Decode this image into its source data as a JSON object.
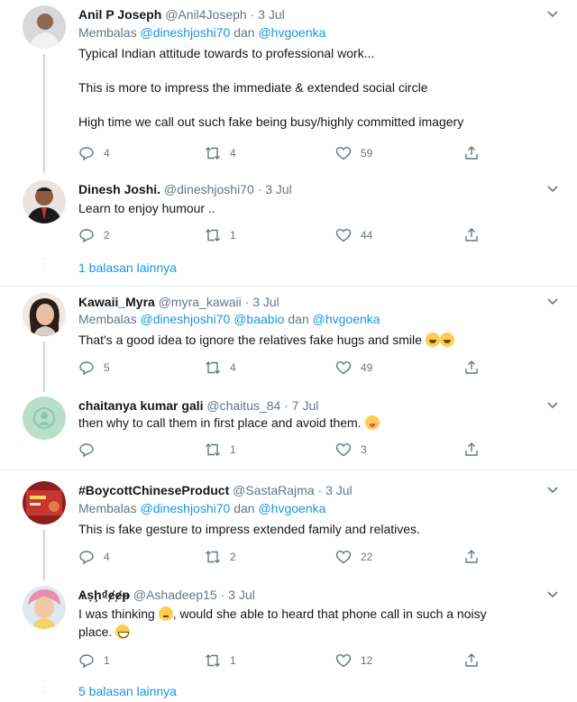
{
  "tweets": [
    {
      "name": "Anil P Joseph",
      "handle": "@Anil4Joseph",
      "date": "3 Jul",
      "reply_prefix": "Membalas",
      "reply_mentions": [
        "@dineshjoshi70",
        "@hvgoenka"
      ],
      "reply_sep": "dan",
      "lines": [
        "Typical Indian attitude towards to professional work...",
        "This is more to impress the immediate & extended social circle",
        "High time we call out such fake being busy/highly committed imagery"
      ],
      "replies": "4",
      "retweets": "4",
      "likes": "59"
    },
    {
      "name": "Dinesh Joshi.",
      "handle": "@dineshjoshi70",
      "date": "3 Jul",
      "lines": [
        "Learn to enjoy humour .."
      ],
      "replies": "2",
      "retweets": "1",
      "likes": "44"
    },
    {
      "name": "Kawaii_Myra",
      "handle": "@myra_kawaii",
      "date": "3 Jul",
      "reply_prefix": "Membalas",
      "reply_mentions": [
        "@dineshjoshi70",
        "@baabio",
        "@hvgoenka"
      ],
      "reply_sep": "dan",
      "lines": [
        "That's a good idea to ignore the relatives fake hugs and smile"
      ],
      "emoji": "rolling-laughing",
      "replies": "5",
      "retweets": "4",
      "likes": "49"
    },
    {
      "name": "chaitanya kumar gali",
      "handle": "@chaitus_84",
      "date": "7 Jul",
      "lines": [
        "then why to call them in first place and avoid them."
      ],
      "emoji": "zany-face",
      "replies": "",
      "retweets": "1",
      "likes": "3"
    },
    {
      "name": "#BoycottChineseProduct",
      "handle": "@SastaRajma",
      "date": "3 Jul",
      "reply_prefix": "Membalas",
      "reply_mentions": [
        "@dineshjoshi70",
        "@hvgoenka"
      ],
      "reply_sep": "dan",
      "lines": [
        "This is fake gesture to impress extended family and relatives."
      ],
      "replies": "4",
      "retweets": "2",
      "likes": "22"
    },
    {
      "name": "Ѧṣḩ₫ɇɇᵽ",
      "handle": "@Ashadeep15",
      "date": "3 Jul",
      "lines": [
        "I was thinking",
        ", would she able to heard that phone call in such a noisy",
        "place."
      ],
      "replies": "1",
      "retweets": "1",
      "likes": "12"
    }
  ],
  "more_replies": [
    "1 balasan lainnya",
    "5 balasan lainnya"
  ],
  "colors": {
    "link": "#1b95e0",
    "muted": "#657786",
    "line": "#ccd6dd",
    "divider": "#e6ecf0"
  }
}
